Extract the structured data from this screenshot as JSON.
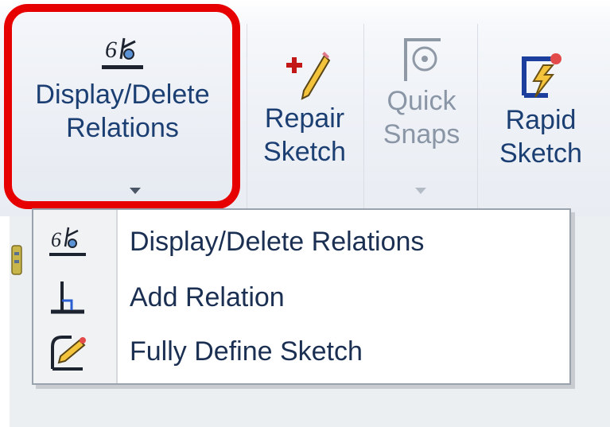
{
  "ribbon": {
    "buttons": [
      {
        "id": "display-delete",
        "line1": "Display/Delete",
        "line2": "Relations",
        "has_dropdown": true,
        "enabled": true,
        "icon": "relations-icon"
      },
      {
        "id": "repair-sketch",
        "line1": "Repair",
        "line2": "Sketch",
        "has_dropdown": false,
        "enabled": true,
        "icon": "repair-sketch-icon"
      },
      {
        "id": "quick-snaps",
        "line1": "Quick",
        "line2": "Snaps",
        "has_dropdown": true,
        "enabled": false,
        "icon": "quick-snaps-icon"
      },
      {
        "id": "rapid-sketch",
        "line1": "Rapid",
        "line2": "Sketch",
        "has_dropdown": false,
        "enabled": true,
        "icon": "rapid-sketch-icon"
      }
    ]
  },
  "dropdown": {
    "items": [
      {
        "label": "Display/Delete Relations",
        "icon": "relations-icon"
      },
      {
        "label": "Add Relation",
        "icon": "add-relation-icon"
      },
      {
        "label": "Fully Define Sketch",
        "icon": "fully-define-sketch-icon"
      }
    ]
  },
  "colors": {
    "highlight": "#e60000",
    "label_text": "#1c3f73",
    "disabled_text": "#8a96a6",
    "menu_text": "#1a2f52"
  }
}
